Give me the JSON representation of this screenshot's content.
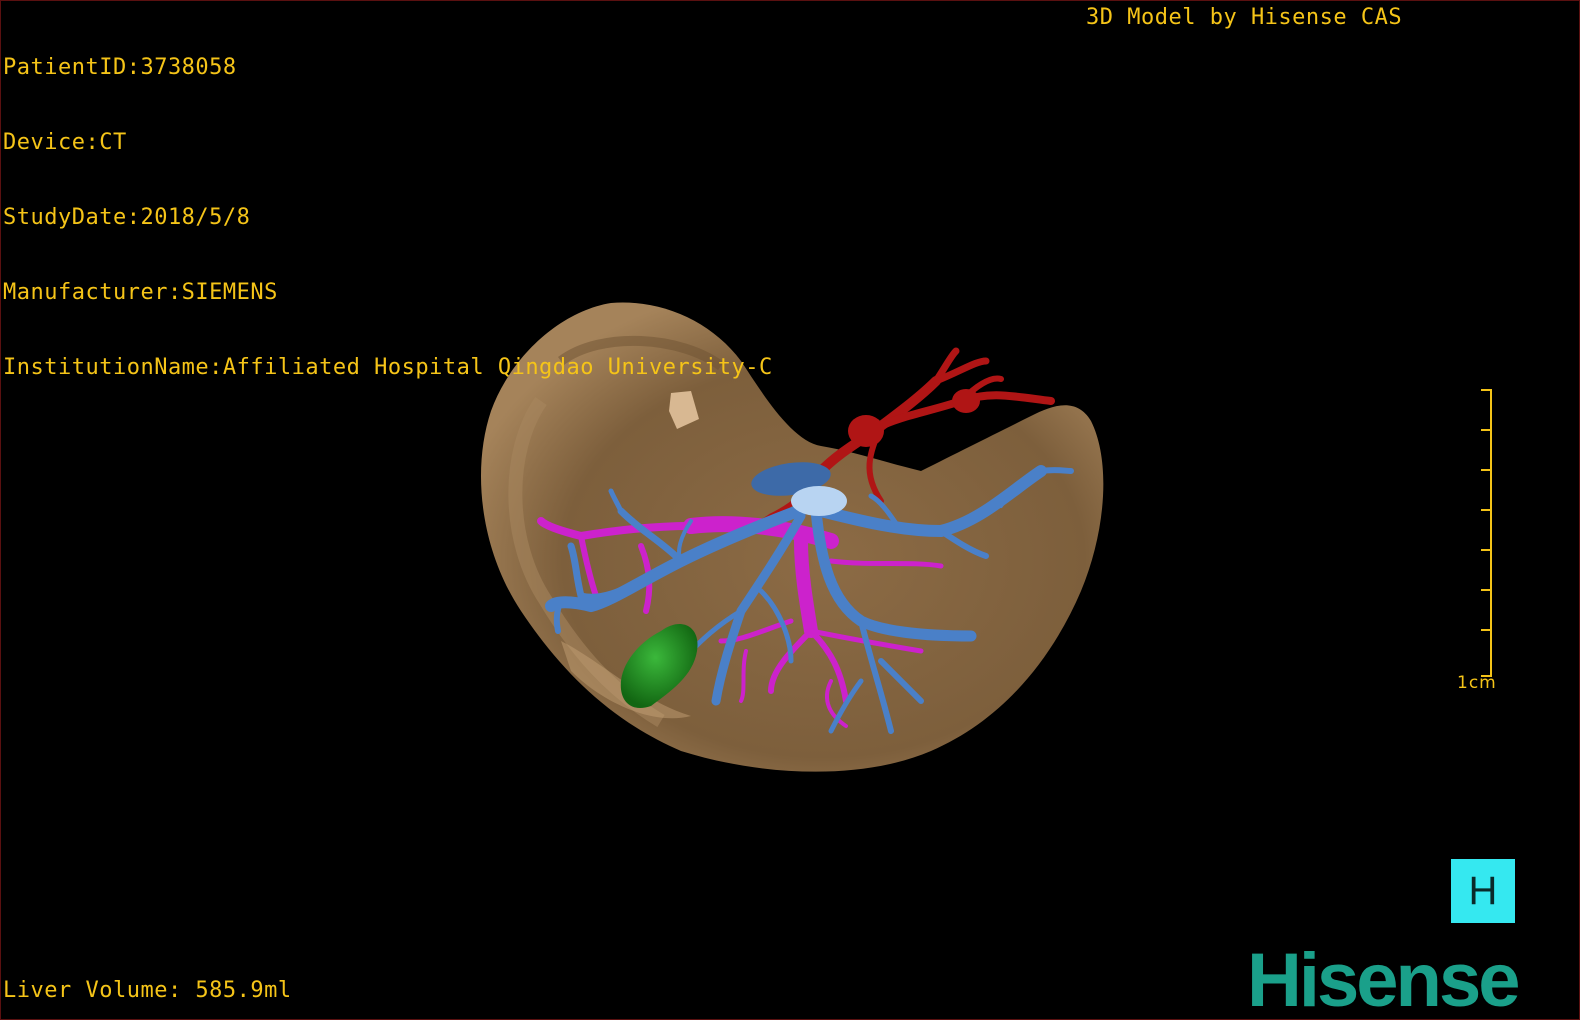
{
  "info": {
    "patient_id": "PatientID:3738058",
    "device": "Device:CT",
    "study_date": "StudyDate:2018/5/8",
    "manufacturer": "Manufacturer:SIEMENS",
    "institution": "InstitutionName:Affiliated Hospital Qingdao University-C"
  },
  "credit": "3D Model by Hisense CAS",
  "scale_label": "1cm",
  "orientation_button": "H",
  "volume": "Liver Volume: 585.9ml",
  "logo": "Hisense",
  "colors": {
    "overlay_text": "#f5c418",
    "liver": "#8a6a45",
    "hepatic_artery": "#b01515",
    "portal_vein": "#cc22cc",
    "hepatic_vein": "#4a80c8",
    "gallbladder": "#1f8f1f",
    "orientation_button": "#35e8f0",
    "logo": "#1aa08a"
  }
}
